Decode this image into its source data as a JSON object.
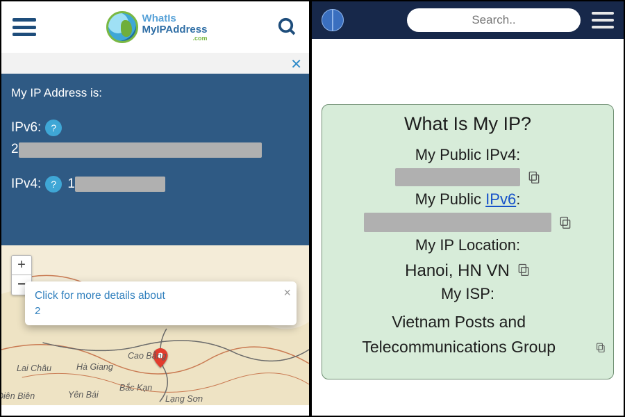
{
  "left": {
    "logo": {
      "line1": "WhatIs",
      "line2": "MyIPAddress",
      "suffix": ".com"
    },
    "ip_title": "My IP Address is:",
    "ipv6_label": "IPv6:",
    "ipv6_first_char": "2",
    "ipv4_label": "IPv4:",
    "ipv4_first_char": "1",
    "zoom_in": "+",
    "zoom_out": "−",
    "popup_link": "Click for more details about",
    "popup_num": "2",
    "cities": {
      "lai_chau": "Lai Châu",
      "ha_giang": "Hà Giang",
      "cao_bang": "Cao Bằng",
      "dien_bien": "Điên Biên",
      "yen_bai": "Yên Bái",
      "bac_kan": "Bắc Kạn",
      "lang_son": "Lạng Sơn"
    }
  },
  "right": {
    "search_placeholder": "Search..",
    "title": "What Is My IP?",
    "ipv4_label": "My Public IPv4:",
    "ipv6_label_prefix": "My Public ",
    "ipv6_link": "IPv6",
    "loc_label": "My IP Location:",
    "loc_value": "Hanoi, HN VN",
    "isp_label": "My ISP:",
    "isp_value": "Vietnam Posts and Telecommunications Group"
  }
}
